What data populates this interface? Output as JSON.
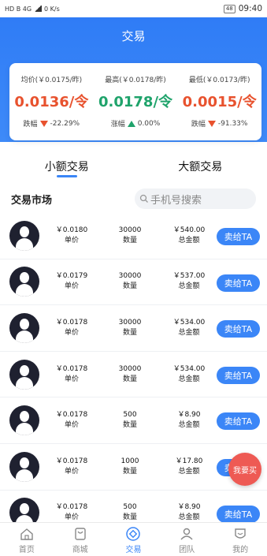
{
  "status_bar": {
    "left": "HD B 4G",
    "speed": "0 K/s",
    "battery": "48",
    "time": "09:40"
  },
  "header": {
    "title": "交易"
  },
  "stats": [
    {
      "label": "均价(￥0.0175/昨)",
      "price": "0.0136/令",
      "change_label": "跌幅",
      "change": "-22.29%",
      "direction": "down"
    },
    {
      "label": "最高(￥0.0178/昨)",
      "price": "0.0178/令",
      "change_label": "涨幅",
      "change": "0.00%",
      "direction": "up"
    },
    {
      "label": "最低(￥0.0173/昨)",
      "price": "0.0015/令",
      "change_label": "跌幅",
      "change": "-91.33%",
      "direction": "down"
    }
  ],
  "tabs": [
    {
      "label": "小额交易",
      "active": true
    },
    {
      "label": "大额交易",
      "active": false
    }
  ],
  "market": {
    "title": "交易市场",
    "search_placeholder": "手机号搜索"
  },
  "columns": {
    "price": "单价",
    "qty": "数量",
    "total": "总金额"
  },
  "sell_label": "卖给TA",
  "rows": [
    {
      "price": "￥0.0180",
      "qty": "30000",
      "total": "￥540.00"
    },
    {
      "price": "￥0.0179",
      "qty": "30000",
      "total": "￥537.00"
    },
    {
      "price": "￥0.0178",
      "qty": "30000",
      "total": "￥534.00"
    },
    {
      "price": "￥0.0178",
      "qty": "30000",
      "total": "￥534.00"
    },
    {
      "price": "￥0.0178",
      "qty": "500",
      "total": "￥8.90"
    },
    {
      "price": "￥0.0178",
      "qty": "1000",
      "total": "￥17.80"
    },
    {
      "price": "￥0.0178",
      "qty": "500",
      "total": "￥8.90"
    }
  ],
  "float_button": "我要买",
  "nav": [
    {
      "label": "首页",
      "icon": "home-icon",
      "active": false
    },
    {
      "label": "商城",
      "icon": "shop-icon",
      "active": false
    },
    {
      "label": "交易",
      "icon": "trade-icon",
      "active": true
    },
    {
      "label": "团队",
      "icon": "team-icon",
      "active": false
    },
    {
      "label": "我的",
      "icon": "profile-icon",
      "active": false
    }
  ],
  "colors": {
    "primary": "#3b86f7",
    "down": "#e8522e",
    "up": "#1fa36b",
    "float": "#ee5a54"
  }
}
